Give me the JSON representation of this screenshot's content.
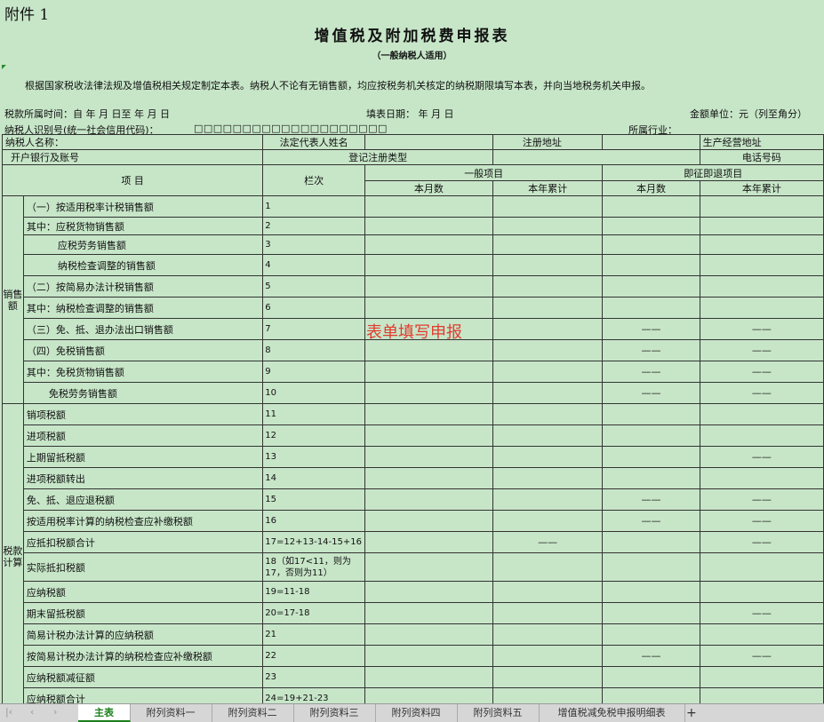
{
  "header": {
    "annex": "附件 1",
    "title": "增值税及附加税费申报表",
    "subtitle": "（一般纳税人适用）",
    "note": "根据国家税收法律法规及增值税相关规定制定本表。纳税人不论有无销售额，均应按税务机关核定的纳税期限填写本表，并向当地税务机关申报。",
    "period": "税款所属时间：自    年    月    日至    年    月    日",
    "fill_date": "填表日期：   年   月   日",
    "unit": "金额单位：元（列至角分）",
    "taxid_label": "纳税人识别号(统一社会信用代码)：",
    "taxid_boxes": "□□□□□□□□□□□□□□□□□□□□",
    "industry": "所属行业："
  },
  "info": {
    "taxpayer_name": "纳税人名称：",
    "legal_rep": "法定代表人姓名",
    "reg_address": "注册地址",
    "biz_address": "生产经营地址",
    "bank": "开户银行及账号",
    "reg_type": "登记注册类型",
    "phone": "电话号码"
  },
  "columns": {
    "item": "项  目",
    "line": "栏次",
    "general": "一般项目",
    "refund": "即征即退项目",
    "month": "本月数",
    "ytd": "本年累计"
  },
  "sections": {
    "sales": "销售额",
    "tax": "税款计算"
  },
  "dash": "——",
  "rows": [
    {
      "label": "（一）按适用税率计税销售额",
      "line": "1",
      "g_ytd_dash": false,
      "r_month_dash": false,
      "r_ytd_dash": false,
      "g_month_dash": false
    },
    {
      "label": "其中：应税货物销售额",
      "line": "2",
      "g_ytd_dash": false,
      "r_month_dash": false,
      "r_ytd_dash": false
    },
    {
      "label": "应税劳务销售额",
      "line": "3",
      "indent": true
    },
    {
      "label": "纳税检查调整的销售额",
      "line": "4",
      "indent": true
    },
    {
      "label": "（二）按简易办法计税销售额",
      "line": "5"
    },
    {
      "label": "其中：纳税检查调整的销售额",
      "line": "6"
    },
    {
      "label": "（三）免、抵、退办法出口销售额",
      "line": "7",
      "r_month_dash": true,
      "r_ytd_dash": true
    },
    {
      "label": "（四）免税销售额",
      "line": "8",
      "r_month_dash": true,
      "r_ytd_dash": true
    },
    {
      "label": "其中：免税货物销售额",
      "line": "9",
      "r_month_dash": true,
      "r_ytd_dash": true
    },
    {
      "label": "免税劳务销售额",
      "line": "10",
      "indent": true,
      "r_month_dash": true,
      "r_ytd_dash": true
    },
    {
      "label": "销项税额",
      "line": "11"
    },
    {
      "label": "进项税额",
      "line": "12"
    },
    {
      "label": "上期留抵税额",
      "line": "13",
      "r_ytd_dash": true
    },
    {
      "label": "进项税额转出",
      "line": "14"
    },
    {
      "label": "免、抵、退应退税额",
      "line": "15",
      "r_month_dash": true,
      "r_ytd_dash": true
    },
    {
      "label": "按适用税率计算的纳税检查应补缴税额",
      "line": "16",
      "r_month_dash": true,
      "r_ytd_dash": true
    },
    {
      "label": "应抵扣税额合计",
      "line": "17=12+13-14-15+16",
      "g_ytd_dash": true,
      "r_ytd_dash": true
    },
    {
      "label": "实际抵扣税额",
      "line": "18（如17<11，则为17，否则为11）",
      "tall": true
    },
    {
      "label": "应纳税额",
      "line": "19=11-18"
    },
    {
      "label": "期末留抵税额",
      "line": "20=17-18",
      "r_ytd_dash": true
    },
    {
      "label": "简易计税办法计算的应纳税额",
      "line": "21"
    },
    {
      "label": "按简易计税办法计算的纳税检查应补缴税额",
      "line": "22",
      "r_month_dash": true,
      "r_ytd_dash": true
    },
    {
      "label": "应纳税额减征额",
      "line": "23"
    },
    {
      "label": "应纳税额合计",
      "line": "24=19+21-23"
    }
  ],
  "overlay": "表单填写申报",
  "tabs": [
    {
      "label": "主表",
      "active": true
    },
    {
      "label": "附列资料一"
    },
    {
      "label": "附列资料二"
    },
    {
      "label": "附列资料三"
    },
    {
      "label": "附列资料四"
    },
    {
      "label": "附列资料五"
    },
    {
      "label": "增值税减免税申报明细表"
    }
  ],
  "add_tab": "+"
}
